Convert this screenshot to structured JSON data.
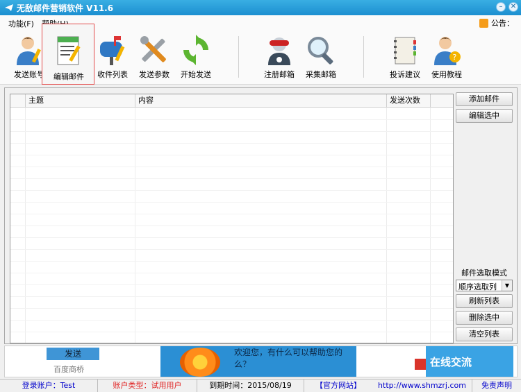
{
  "window": {
    "title": "无敌邮件营销软件   V11.6"
  },
  "menu": {
    "items": [
      "功能(F)",
      "帮助(H)"
    ],
    "notice_label": "公告："
  },
  "toolbar": {
    "buttons": [
      "发送账号",
      "编辑邮件",
      "收件列表",
      "发送参数",
      "开始发送",
      "注册邮箱",
      "采集邮箱",
      "投诉建议",
      "使用教程"
    ]
  },
  "table": {
    "columns": [
      "主题",
      "内容",
      "发送次数"
    ],
    "rows": []
  },
  "side_panel": {
    "add_mail": "添加邮件",
    "edit_selected": "编辑选中",
    "mode_label": "邮件选取模式",
    "mode_value": "顺序选取列",
    "refresh_list": "刷新列表",
    "delete_selected": "删除选中",
    "clear_list": "清空列表"
  },
  "ad": {
    "send_label": "发送",
    "baidu_label": "百度商桥",
    "chat_text": "欢迎您，有什么可以帮助您的么？",
    "online_label": "在线交流"
  },
  "status": {
    "login_account": "登录账户：Test",
    "account_type": "账户类型：试用用户",
    "expiry": "到期时间：2015/08/19",
    "official_site": "【官方网站】",
    "url": "http://www.shmzrj.com",
    "disclaimer": "免责声明"
  },
  "colors": {
    "titlebar": "#1c8fd0",
    "account_type_text": "#e02020",
    "link_text": "#0000cc",
    "active_border": "#e34b4b"
  }
}
